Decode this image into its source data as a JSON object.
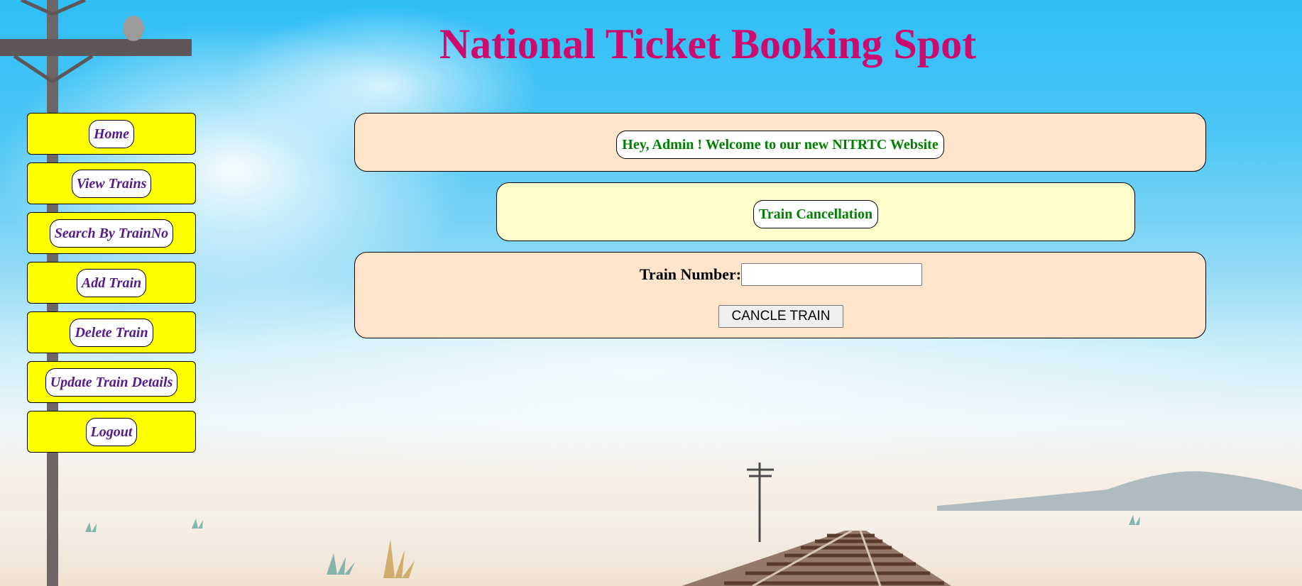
{
  "page": {
    "title": "National Ticket Booking Spot"
  },
  "sidebar": {
    "items": [
      {
        "label": "Home"
      },
      {
        "label": "View Trains"
      },
      {
        "label": "Search By TrainNo"
      },
      {
        "label": "Add Train"
      },
      {
        "label": "Delete Train"
      },
      {
        "label": "Update Train Details"
      },
      {
        "label": "Logout"
      }
    ]
  },
  "main": {
    "welcome": "Hey, Admin ! Welcome to our new NITRTC Website",
    "section_title": "Train Cancellation",
    "form": {
      "train_number_label": "Train Number:",
      "train_number_value": "",
      "submit_label": "CANCLE TRAIN"
    }
  },
  "colors": {
    "title": "#cc0b6e",
    "nav_box": "#ffff00",
    "nav_link": "#551a8b",
    "panel_peach": "#ffe4cc",
    "panel_yellow": "#ffffcc",
    "heading_green": "#008000"
  }
}
